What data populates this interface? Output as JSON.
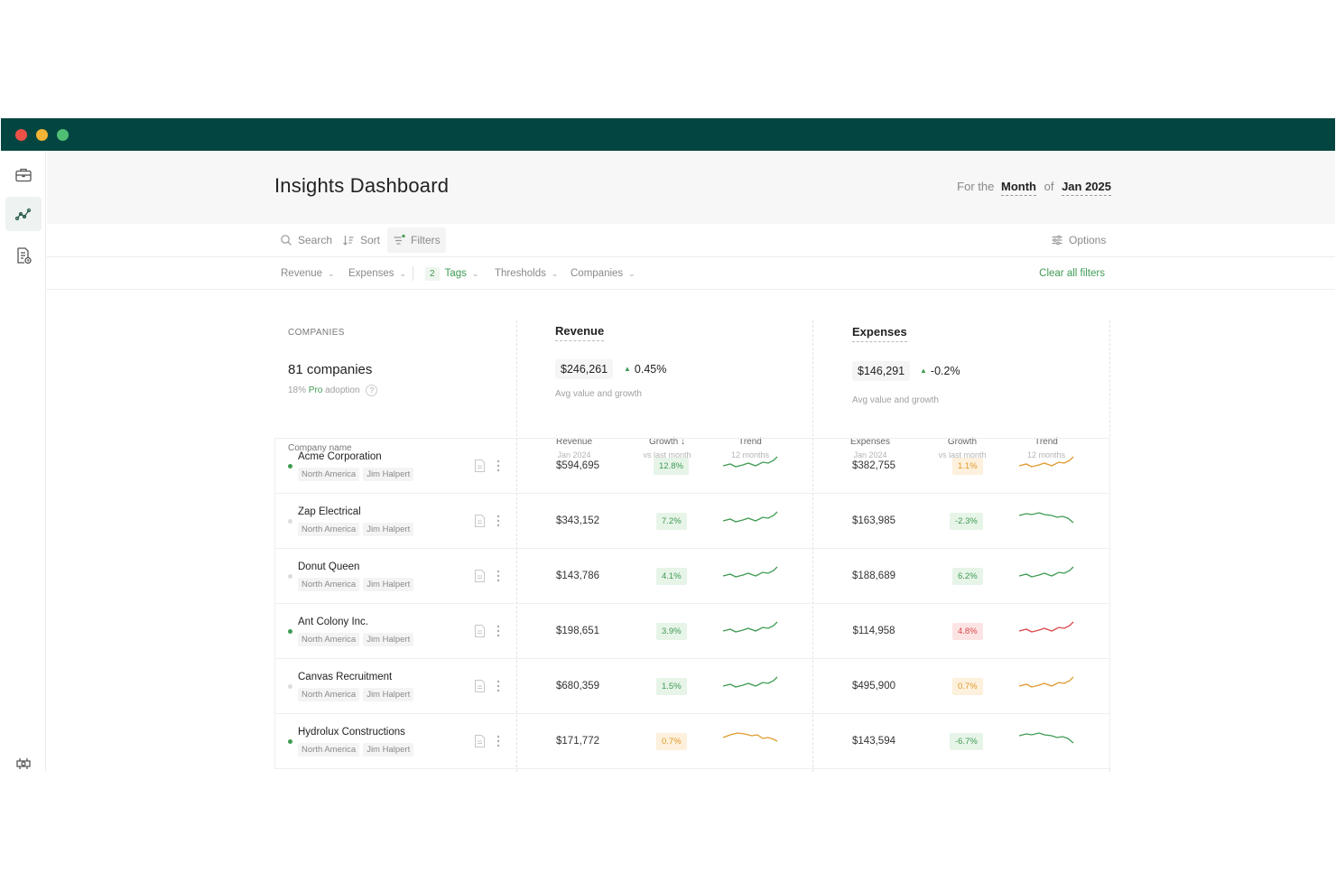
{
  "header": {
    "title": "Insights Dashboard",
    "period_prefix": "For the",
    "period_unit": "Month",
    "period_of": "of",
    "period_value": "Jan 2025"
  },
  "toolbar": {
    "search": "Search",
    "sort": "Sort",
    "filters": "Filters",
    "options": "Options"
  },
  "filters": {
    "revenue": "Revenue",
    "expenses": "Expenses",
    "tags_count": "2",
    "tags": "Tags",
    "thresholds": "Thresholds",
    "companies": "Companies",
    "clear": "Clear all filters"
  },
  "companies_section": {
    "label": "COMPANIES",
    "count": "81 companies",
    "adoption_pct": "18%",
    "adoption_plan": "Pro",
    "adoption_suffix": "adoption",
    "col_name": "Company name"
  },
  "revenue_section": {
    "title": "Revenue",
    "avg_value": "$246,261",
    "growth": "0.45%",
    "caption": "Avg value and growth",
    "cols": [
      {
        "label": "Revenue",
        "sub": "Jan 2024"
      },
      {
        "label": "Growth ↓",
        "sub": "vs last month"
      },
      {
        "label": "Trend",
        "sub": "12 months"
      }
    ]
  },
  "expenses_section": {
    "title": "Expenses",
    "avg_value": "$146,291",
    "growth": "-0.2%",
    "caption": "Avg value and growth",
    "cols": [
      {
        "label": "Expenses",
        "sub": "Jan 2024"
      },
      {
        "label": "Growth",
        "sub": "vs last month"
      },
      {
        "label": "Trend",
        "sub": "12 months"
      }
    ]
  },
  "rows": [
    {
      "name": "Acme Corporation",
      "region": "North America",
      "owner": "Jim Halpert",
      "status": "active",
      "revenue": "$594,695",
      "rev_growth": "12.8%",
      "rev_tone": "green",
      "expenses": "$382,755",
      "exp_growth": "1.1%",
      "exp_tone": "orange"
    },
    {
      "name": "Zap Electrical",
      "region": "North America",
      "owner": "Jim Halpert",
      "status": "inactive",
      "revenue": "$343,152",
      "rev_growth": "7.2%",
      "rev_tone": "green",
      "expenses": "$163,985",
      "exp_growth": "-2.3%",
      "exp_tone": "green"
    },
    {
      "name": "Donut Queen",
      "region": "North America",
      "owner": "Jim Halpert",
      "status": "inactive",
      "revenue": "$143,786",
      "rev_growth": "4.1%",
      "rev_tone": "green",
      "expenses": "$188,689",
      "exp_growth": "6.2%",
      "exp_tone": "green"
    },
    {
      "name": "Ant Colony Inc.",
      "region": "North America",
      "owner": "Jim Halpert",
      "status": "active",
      "revenue": "$198,651",
      "rev_growth": "3.9%",
      "rev_tone": "green",
      "expenses": "$114,958",
      "exp_growth": "4.8%",
      "exp_tone": "red"
    },
    {
      "name": "Canvas Recruitment",
      "region": "North America",
      "owner": "Jim Halpert",
      "status": "inactive",
      "revenue": "$680,359",
      "rev_growth": "1.5%",
      "rev_tone": "green",
      "expenses": "$495,900",
      "exp_growth": "0.7%",
      "exp_tone": "orange"
    },
    {
      "name": "Hydrolux Constructions",
      "region": "North America",
      "owner": "Jim Halpert",
      "status": "active",
      "revenue": "$171,772",
      "rev_growth": "0.7%",
      "rev_tone": "orange",
      "expenses": "$143,594",
      "exp_growth": "-6.7%",
      "exp_tone": "green"
    }
  ],
  "colors": {
    "titlebar": "#034641",
    "accent_green": "#3f9b53",
    "orange": "#e09a2d",
    "red": "#d9474a"
  },
  "icons": {
    "sidebar": [
      "briefcase-icon",
      "analytics-icon",
      "report-icon",
      "settings-icon"
    ]
  }
}
